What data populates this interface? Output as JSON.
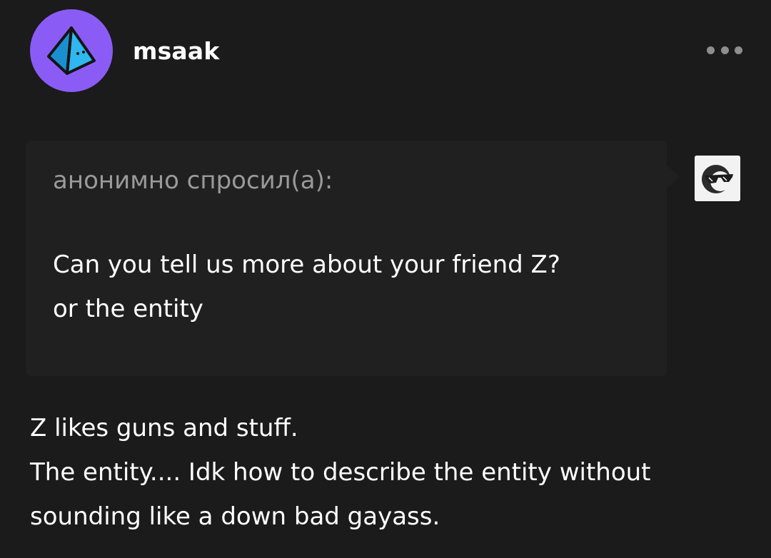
{
  "post": {
    "author": {
      "username": "msaak",
      "avatar_icon": "pyramid-avatar-icon",
      "avatar_bg": "#8a5cf5"
    },
    "menu_icon": "more-options-icon",
    "ask": {
      "asker_label": "анонимно спросил(а):",
      "asker_avatar_icon": "anonymous-sunglasses-icon",
      "question_lines": [
        "Can you tell us more about your friend Z?",
        "or the entity"
      ]
    },
    "answer_lines": [
      "Z likes guns and stuff.",
      "The entity.... Idk how to describe the entity without",
      "sounding like a down bad gayass."
    ]
  },
  "colors": {
    "background": "#1b1b1b",
    "ask_box": "#202020",
    "muted_text": "#9a9a9a",
    "text": "#ffffff"
  }
}
